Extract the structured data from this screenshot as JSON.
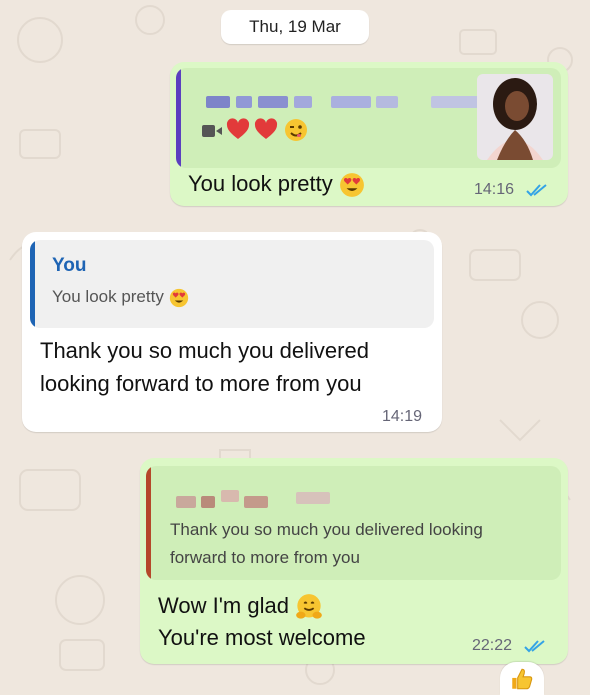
{
  "date_separator": "Thu, 19 Mar",
  "messages": [
    {
      "quote": {
        "author_hidden": true,
        "thumbnail": "photo-thumbnail",
        "media_icons": [
          "video-icon",
          "heart-emoji",
          "heart-emoji",
          "wink-emoji"
        ]
      },
      "text": "You look pretty",
      "emoji": "heart-eyes-emoji",
      "time": "14:16",
      "status": "read-double-check"
    },
    {
      "quote": {
        "author": "You",
        "text": "You look pretty",
        "emoji": "heart-eyes-emoji"
      },
      "text_line1": "Thank you so much you delivered",
      "text_line2": "looking forward to more from you",
      "time": "14:19"
    },
    {
      "quote": {
        "author_hidden": true,
        "text_line1": "Thank you so much you delivered looking",
        "text_line2": "forward to more from you"
      },
      "text_line1": "Wow I'm glad",
      "emoji": "hugging-face-emoji",
      "text_line2": "You're most welcome",
      "time": "22:22",
      "status": "read-double-check",
      "reaction": "thumbs-up-emoji"
    }
  ],
  "colors": {
    "outgoing_bubble": "#dcf8c6",
    "incoming_bubble": "#ffffff",
    "read_tick": "#34a3e6",
    "quote_author_you": "#1e64b4"
  }
}
